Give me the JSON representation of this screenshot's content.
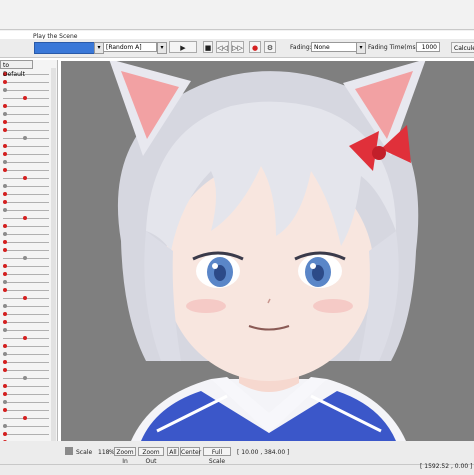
{
  "header": {
    "scene_label": "Play the Scene"
  },
  "toolbar": {
    "random_select": "[Random A]",
    "play": "▶",
    "stop": "■",
    "prev": "◁◁",
    "next": "▷▷",
    "record": "●",
    "settings": "⚙",
    "fading_label": "Fading:",
    "fading_value": "None",
    "fading_time_label": "Fading Time(ms):",
    "fading_time_value": "1000",
    "calc_label": "Calcule"
  },
  "left_panel": {
    "default_button": "to Default"
  },
  "statusbar": {
    "scale_label": "Scale",
    "scale_value": "118",
    "scale_unit": "%",
    "zoom_in": "Zoom In",
    "zoom_out": "Zoom Out",
    "all": "All",
    "center": "Center",
    "full_scale": "Full Scale",
    "coords": "[    10.00 ,   384.00 ]",
    "bottom_coords": "[ 1592.52 , 0.00 ]"
  },
  "colors": {
    "accent": "#3a78d8",
    "record": "#d42020",
    "viewport_bg": "#7f7f7f"
  },
  "icons": {
    "record": "record-icon",
    "settings": "gear-icon",
    "play": "play-icon"
  }
}
